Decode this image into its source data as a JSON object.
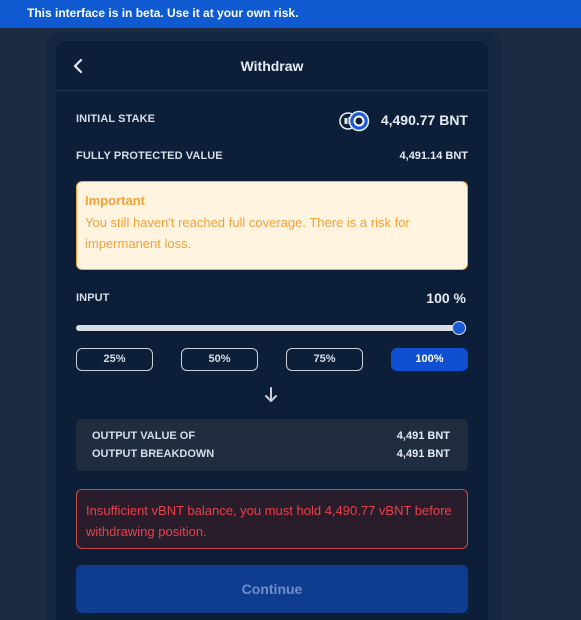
{
  "banner": {
    "text": "This interface is in beta. Use it at your own risk."
  },
  "header": {
    "title": "Withdraw",
    "back_icon": "chevron-left-icon"
  },
  "stake": {
    "initial_label": "INITIAL STAKE",
    "initial_value": "4,490.77 BNT",
    "protected_label": "FULLY PROTECTED VALUE",
    "protected_value": "4,491.14 BNT",
    "token_icons": [
      "bancor-token-icon",
      "bnt-token-icon"
    ]
  },
  "important": {
    "title": "Important",
    "text": "You still haven't reached full coverage. There is a risk for impermanent loss."
  },
  "input": {
    "label": "INPUT",
    "value": "100 %",
    "slider_fraction": 1.0,
    "presets": [
      "25%",
      "50%",
      "75%",
      "100%"
    ],
    "selected_preset": "100%"
  },
  "output": {
    "value_label": "OUTPUT VALUE OF",
    "value": "4,491 BNT",
    "breakdown_label": "OUTPUT BREAKDOWN",
    "breakdown": "4,491 BNT"
  },
  "error": {
    "text": "Insufficient vBNT balance, you must hold 4,490.77 vBNT before withdrawing position."
  },
  "actions": {
    "continue_label": "Continue"
  },
  "colors": {
    "accent": "#0f4fd0",
    "warning": "#f2a03a",
    "error": "#e8414a",
    "banner": "#0f59d1"
  }
}
